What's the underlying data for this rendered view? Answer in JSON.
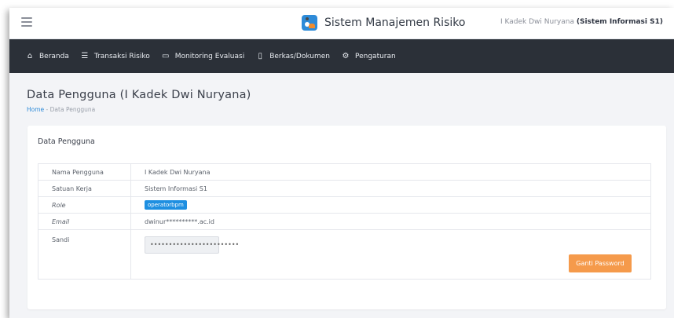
{
  "header": {
    "app_title": "Sistem Manajemen Risiko",
    "user_name": "I Kadek Dwi Nuryana",
    "user_unit": "(Sistem Informasi S1)"
  },
  "nav": {
    "items": [
      {
        "label": "Beranda",
        "icon": "home-icon"
      },
      {
        "label": "Transaksi Risiko",
        "icon": "list-icon"
      },
      {
        "label": "Monitoring Evaluasi",
        "icon": "monitor-icon"
      },
      {
        "label": "Berkas/Dokumen",
        "icon": "document-icon"
      },
      {
        "label": "Pengaturan",
        "icon": "gear-icon"
      }
    ]
  },
  "page": {
    "title": "Data Pengguna (I Kadek Dwi Nuryana)",
    "breadcrumb": {
      "home": "Home",
      "separator": "-",
      "current": "Data Pengguna"
    }
  },
  "card": {
    "title": "Data Pengguna",
    "rows": [
      {
        "label": "Nama Pengguna",
        "value": "I Kadek Dwi Nuryana"
      },
      {
        "label": "Satuan Kerja",
        "value": "Sistem Informasi S1"
      },
      {
        "label": "Role",
        "value": "operatorbpm"
      },
      {
        "label": "Email",
        "value": "dwinur**********.ac.id"
      },
      {
        "label": "Sandi",
        "value": "••••••••••••••••••••••••"
      }
    ],
    "change_password_label": "Ganti Password"
  },
  "colors": {
    "navbar_bg": "#2b3038",
    "badge_bg": "#1e8fe1",
    "button_bg": "#f59a4b",
    "link": "#2e8bd8"
  }
}
